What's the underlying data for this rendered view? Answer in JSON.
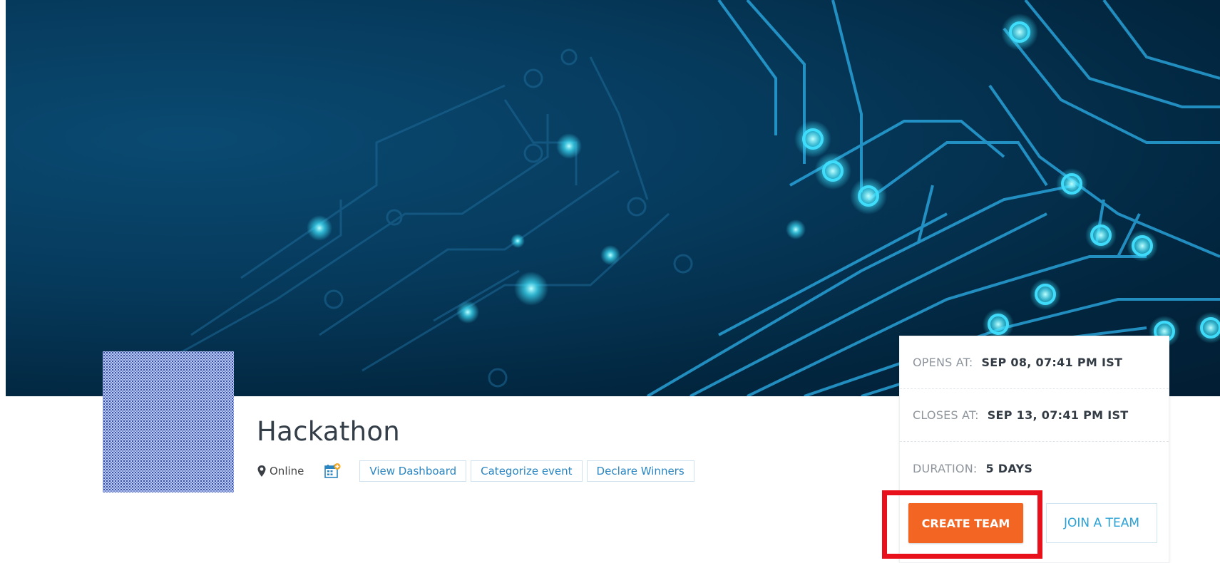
{
  "event": {
    "title": "Hackathon",
    "location": "Online"
  },
  "actions": {
    "view_dashboard": "View Dashboard",
    "categorize_event": "Categorize event",
    "declare_winners": "Declare Winners"
  },
  "schedule": {
    "opens_label": "OPENS AT:",
    "opens_value": "SEP 08, 07:41 PM IST",
    "closes_label": "CLOSES AT:",
    "closes_value": "SEP 13, 07:41 PM IST",
    "duration_label": "DURATION:",
    "duration_value": "5 DAYS"
  },
  "team": {
    "create_label": "CREATE TEAM",
    "join_label": "JOIN A TEAM"
  },
  "colors": {
    "primary": "#f26522",
    "link": "#2a86c2",
    "highlight": "#e8101b"
  },
  "icons": {
    "location": "map-pin-icon",
    "calendar": "calendar-add-icon"
  }
}
